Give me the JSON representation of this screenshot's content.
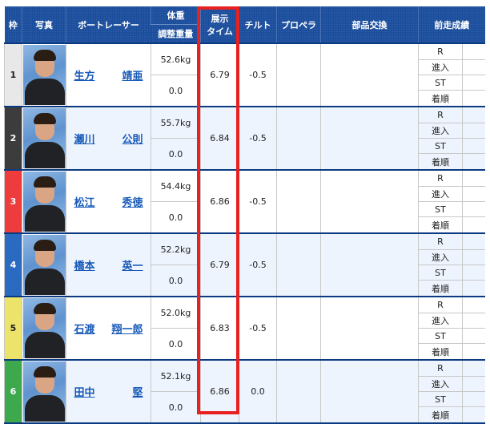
{
  "header": {
    "frame": "枠",
    "photo": "写真",
    "racer": "ボートレーサー",
    "weight": "体重",
    "weight_adjust": "調整重量",
    "exhibit_time_line1": "展示",
    "exhibit_time_line2": "タイム",
    "tilt": "チルト",
    "propeller": "プロペラ",
    "parts": "部品交換",
    "prev_results": "前走成績"
  },
  "prev_labels": [
    "R",
    "進入",
    "ST",
    "着順"
  ],
  "racers": [
    {
      "frame": "1",
      "frame_color": "#e8e8e8",
      "frame_text_color": "#222222",
      "surname": "生方",
      "given": "靖亜",
      "weight": "52.6kg",
      "adjust": "0.0",
      "exhibit_time": "6.79",
      "tilt": "-0.5",
      "propeller": "",
      "parts": ""
    },
    {
      "frame": "2",
      "frame_color": "#3c3c3c",
      "frame_text_color": "#ffffff",
      "surname": "瀬川",
      "given": "公則",
      "weight": "55.7kg",
      "adjust": "0.0",
      "exhibit_time": "6.84",
      "tilt": "-0.5",
      "propeller": "",
      "parts": ""
    },
    {
      "frame": "3",
      "frame_color": "#ee3b3b",
      "frame_text_color": "#ffffff",
      "surname": "松江",
      "given": "秀徳",
      "weight": "54.4kg",
      "adjust": "0.0",
      "exhibit_time": "6.86",
      "tilt": "-0.5",
      "propeller": "",
      "parts": ""
    },
    {
      "frame": "4",
      "frame_color": "#2a6ac0",
      "frame_text_color": "#ffffff",
      "surname": "橋本",
      "given": "英一",
      "weight": "52.2kg",
      "adjust": "0.0",
      "exhibit_time": "6.79",
      "tilt": "-0.5",
      "propeller": "",
      "parts": ""
    },
    {
      "frame": "5",
      "frame_color": "#ece36a",
      "frame_text_color": "#222222",
      "surname": "石渡",
      "given": "翔一郎",
      "weight": "52.0kg",
      "adjust": "0.0",
      "exhibit_time": "6.83",
      "tilt": "-0.5",
      "propeller": "",
      "parts": ""
    },
    {
      "frame": "6",
      "frame_color": "#3ea84c",
      "frame_text_color": "#ffffff",
      "surname": "田中",
      "given": "堅",
      "weight": "52.1kg",
      "adjust": "0.0",
      "exhibit_time": "6.86",
      "tilt": "0.0",
      "propeller": "",
      "parts": ""
    }
  ],
  "highlight_color": "#e8201f",
  "header_color": "#1a4d9c",
  "link_color": "#1659b8"
}
